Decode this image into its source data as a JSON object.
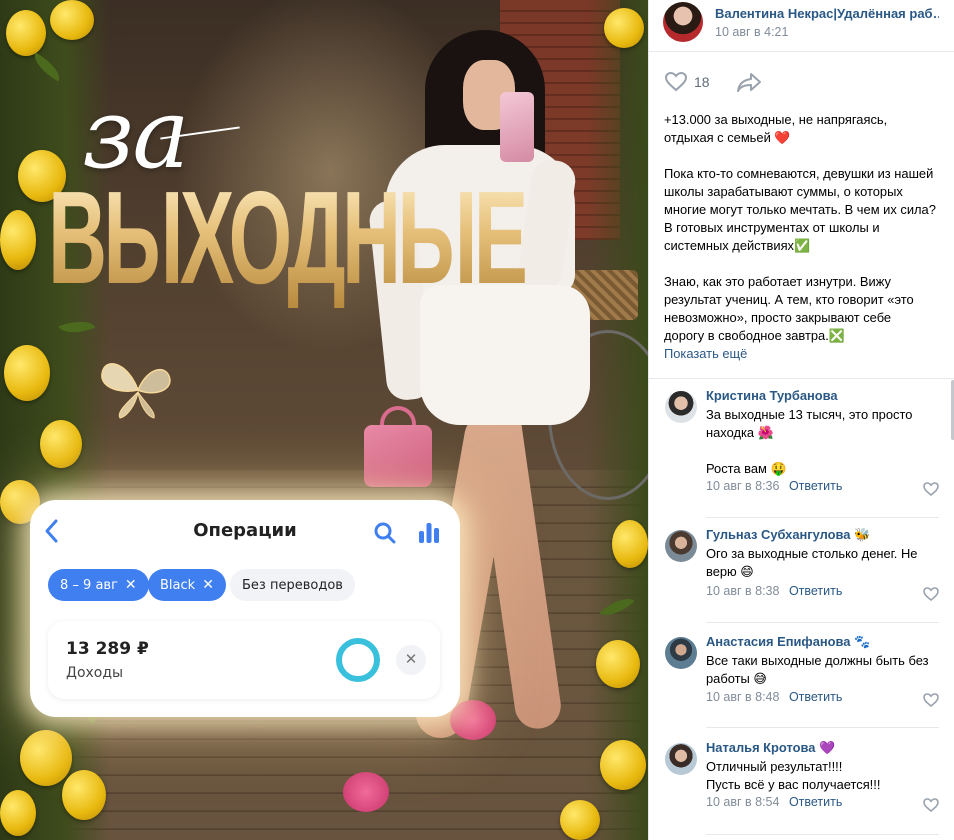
{
  "photo": {
    "title_small": "за",
    "title_big": "ВЫХОДНЫЕ",
    "app_card": {
      "title": "Операции",
      "chips": [
        {
          "label": "8 – 9 авг",
          "close": "✕"
        },
        {
          "label": "Black",
          "close": "✕"
        },
        {
          "label": "Без переводов"
        }
      ],
      "income_amount": "13 289 ₽",
      "income_label": "Доходы",
      "close_symbol": "✕"
    }
  },
  "post": {
    "author": "Валентина Некрас|Удалённая раб…",
    "date": "10 авг в 4:21",
    "likes": "18",
    "text": {
      "p1": "+13.000 за выходные, не напрягаясь,",
      "p2": "отдыхая с семьей ❤️",
      "p3": "Пока кто-то сомневаются, девушки из нашей",
      "p4": "школы зарабатывают суммы, о которых",
      "p5": "многие могут только мечтать. В чем их сила?",
      "p6": "В готовых инструментах от школы и",
      "p7": "системных действиях✅",
      "p8": "Знаю, как это работает изнутри. Вижу",
      "p9": "результат учениц. А тем, кто говорит «это",
      "p10": "невозможно», просто закрывают себе",
      "p11": "дорогу в свободное завтра.❎"
    },
    "show_more": "Показать ещё"
  },
  "comments": [
    {
      "name": "Кристина Турбанова",
      "lines": [
        "За выходные 13 тысяч, это просто",
        "находка 🌺",
        "",
        "Роста вам 🤑"
      ],
      "date": "10 авг в 8:36",
      "reply": "Ответить"
    },
    {
      "name": "Гульназ Субхангулова 🐝",
      "lines": [
        "Ого за выходные столько денег. Не",
        "верю 😄"
      ],
      "date": "10 авг в 8:38",
      "reply": "Ответить"
    },
    {
      "name": "Анастасия Епифанова 🐾",
      "lines": [
        "Все таки выходные должны быть без",
        "работы 😅"
      ],
      "date": "10 авг в 8:48",
      "reply": "Ответить"
    },
    {
      "name": "Наталья Кротова 💜",
      "lines": [
        "Отличный результат!!!!",
        "Пусть всё у вас получается!!!"
      ],
      "date": "10 авг в 8:54",
      "reply": "Ответить"
    }
  ],
  "colors": {
    "link": "#2a5885",
    "meta": "#818c99",
    "chip_blue": "#3f7ff0",
    "ring": "#39c0dd",
    "title_gold": "#e6c07a"
  }
}
